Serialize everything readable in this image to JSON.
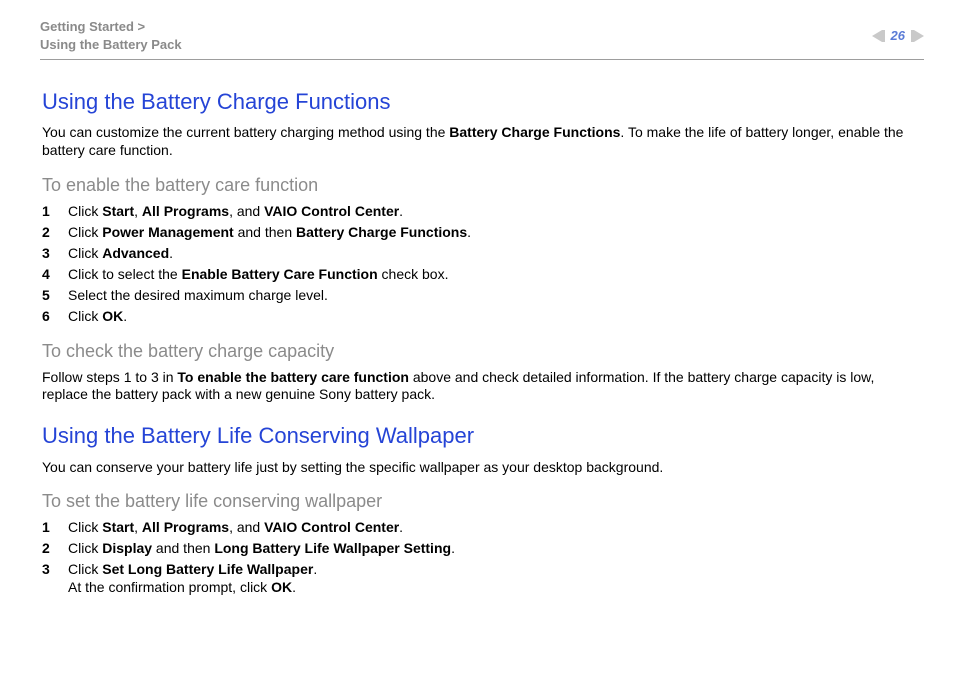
{
  "header": {
    "breadcrumb_line1": "Getting Started >",
    "breadcrumb_line2": "Using the Battery Pack",
    "page_number": "26"
  },
  "section1": {
    "title": "Using the Battery Charge Functions",
    "intro_pre": "You can customize the current battery charging method using the ",
    "intro_bold": "Battery Charge Functions",
    "intro_post": ". To make the life of battery longer, enable the battery care function.",
    "sub1": {
      "title": "To enable the battery care function",
      "steps": [
        {
          "n": "1",
          "pre": "Click ",
          "b1": "Start",
          "mid1": ", ",
          "b2": "All Programs",
          "mid2": ", and ",
          "b3": "VAIO Control Center",
          "post": "."
        },
        {
          "n": "2",
          "pre": "Click ",
          "b1": "Power Management",
          "mid1": " and then ",
          "b2": "Battery Charge Functions",
          "post": "."
        },
        {
          "n": "3",
          "pre": "Click ",
          "b1": "Advanced",
          "post": "."
        },
        {
          "n": "4",
          "pre": "Click to select the ",
          "b1": "Enable Battery Care Function",
          "post": " check box."
        },
        {
          "n": "5",
          "pre": "Select the desired maximum charge level."
        },
        {
          "n": "6",
          "pre": "Click ",
          "b1": "OK",
          "post": "."
        }
      ]
    },
    "sub2": {
      "title": "To check the battery charge capacity",
      "para_pre": "Follow steps 1 to 3 in ",
      "para_bold": "To enable the battery care function",
      "para_post": " above and check detailed information. If the battery charge capacity is low, replace the battery pack with a new genuine Sony battery pack."
    }
  },
  "section2": {
    "title": "Using the Battery Life Conserving Wallpaper",
    "intro": "You can conserve your battery life just by setting the specific wallpaper as your desktop background.",
    "sub1": {
      "title": "To set the battery life conserving wallpaper",
      "steps": [
        {
          "n": "1",
          "pre": "Click ",
          "b1": "Start",
          "mid1": ", ",
          "b2": "All Programs",
          "mid2": ", and ",
          "b3": "VAIO Control Center",
          "post": "."
        },
        {
          "n": "2",
          "pre": "Click ",
          "b1": "Display",
          "mid1": " and then ",
          "b2": "Long Battery Life Wallpaper Setting",
          "post": "."
        },
        {
          "n": "3",
          "pre": "Click ",
          "b1": "Set Long Battery Life Wallpaper",
          "post": ".",
          "line2_pre": "At the confirmation prompt, click ",
          "line2_b": "OK",
          "line2_post": "."
        }
      ]
    }
  }
}
